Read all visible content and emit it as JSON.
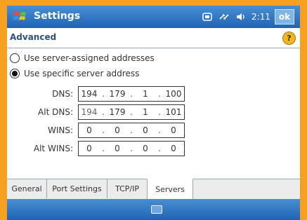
{
  "titlebar": {
    "app_title": "Settings",
    "time": "2:11",
    "ok_label": "ok"
  },
  "section": {
    "title": "Advanced",
    "help_label": "?"
  },
  "radios": [
    {
      "label": "Use server-assigned addresses",
      "checked": false
    },
    {
      "label": "Use specific server address",
      "checked": true
    }
  ],
  "fields": [
    {
      "label": "DNS:",
      "octets": [
        "194",
        "179",
        "1",
        "100"
      ]
    },
    {
      "label": "Alt DNS:",
      "octets": [
        "194",
        "179",
        "1",
        "101"
      ]
    },
    {
      "label": "WINS:",
      "octets": [
        "0",
        "0",
        "0",
        "0"
      ]
    },
    {
      "label": "Alt WINS:",
      "octets": [
        "0",
        "0",
        "0",
        "0"
      ]
    }
  ],
  "tabs": [
    {
      "label": "General"
    },
    {
      "label": "Port Settings"
    },
    {
      "label": "TCP/IP"
    },
    {
      "label": "Servers",
      "active": true
    }
  ],
  "colors": {
    "frame": "#f5a020",
    "titlebar": "#1f63b5",
    "accent": "#2d4f7a"
  },
  "icons": {
    "start": "windows-flag-icon",
    "network": "network-icon",
    "connectivity": "connectivity-icon",
    "volume": "volume-icon",
    "help": "help-icon",
    "keyboard": "keyboard-icon"
  }
}
